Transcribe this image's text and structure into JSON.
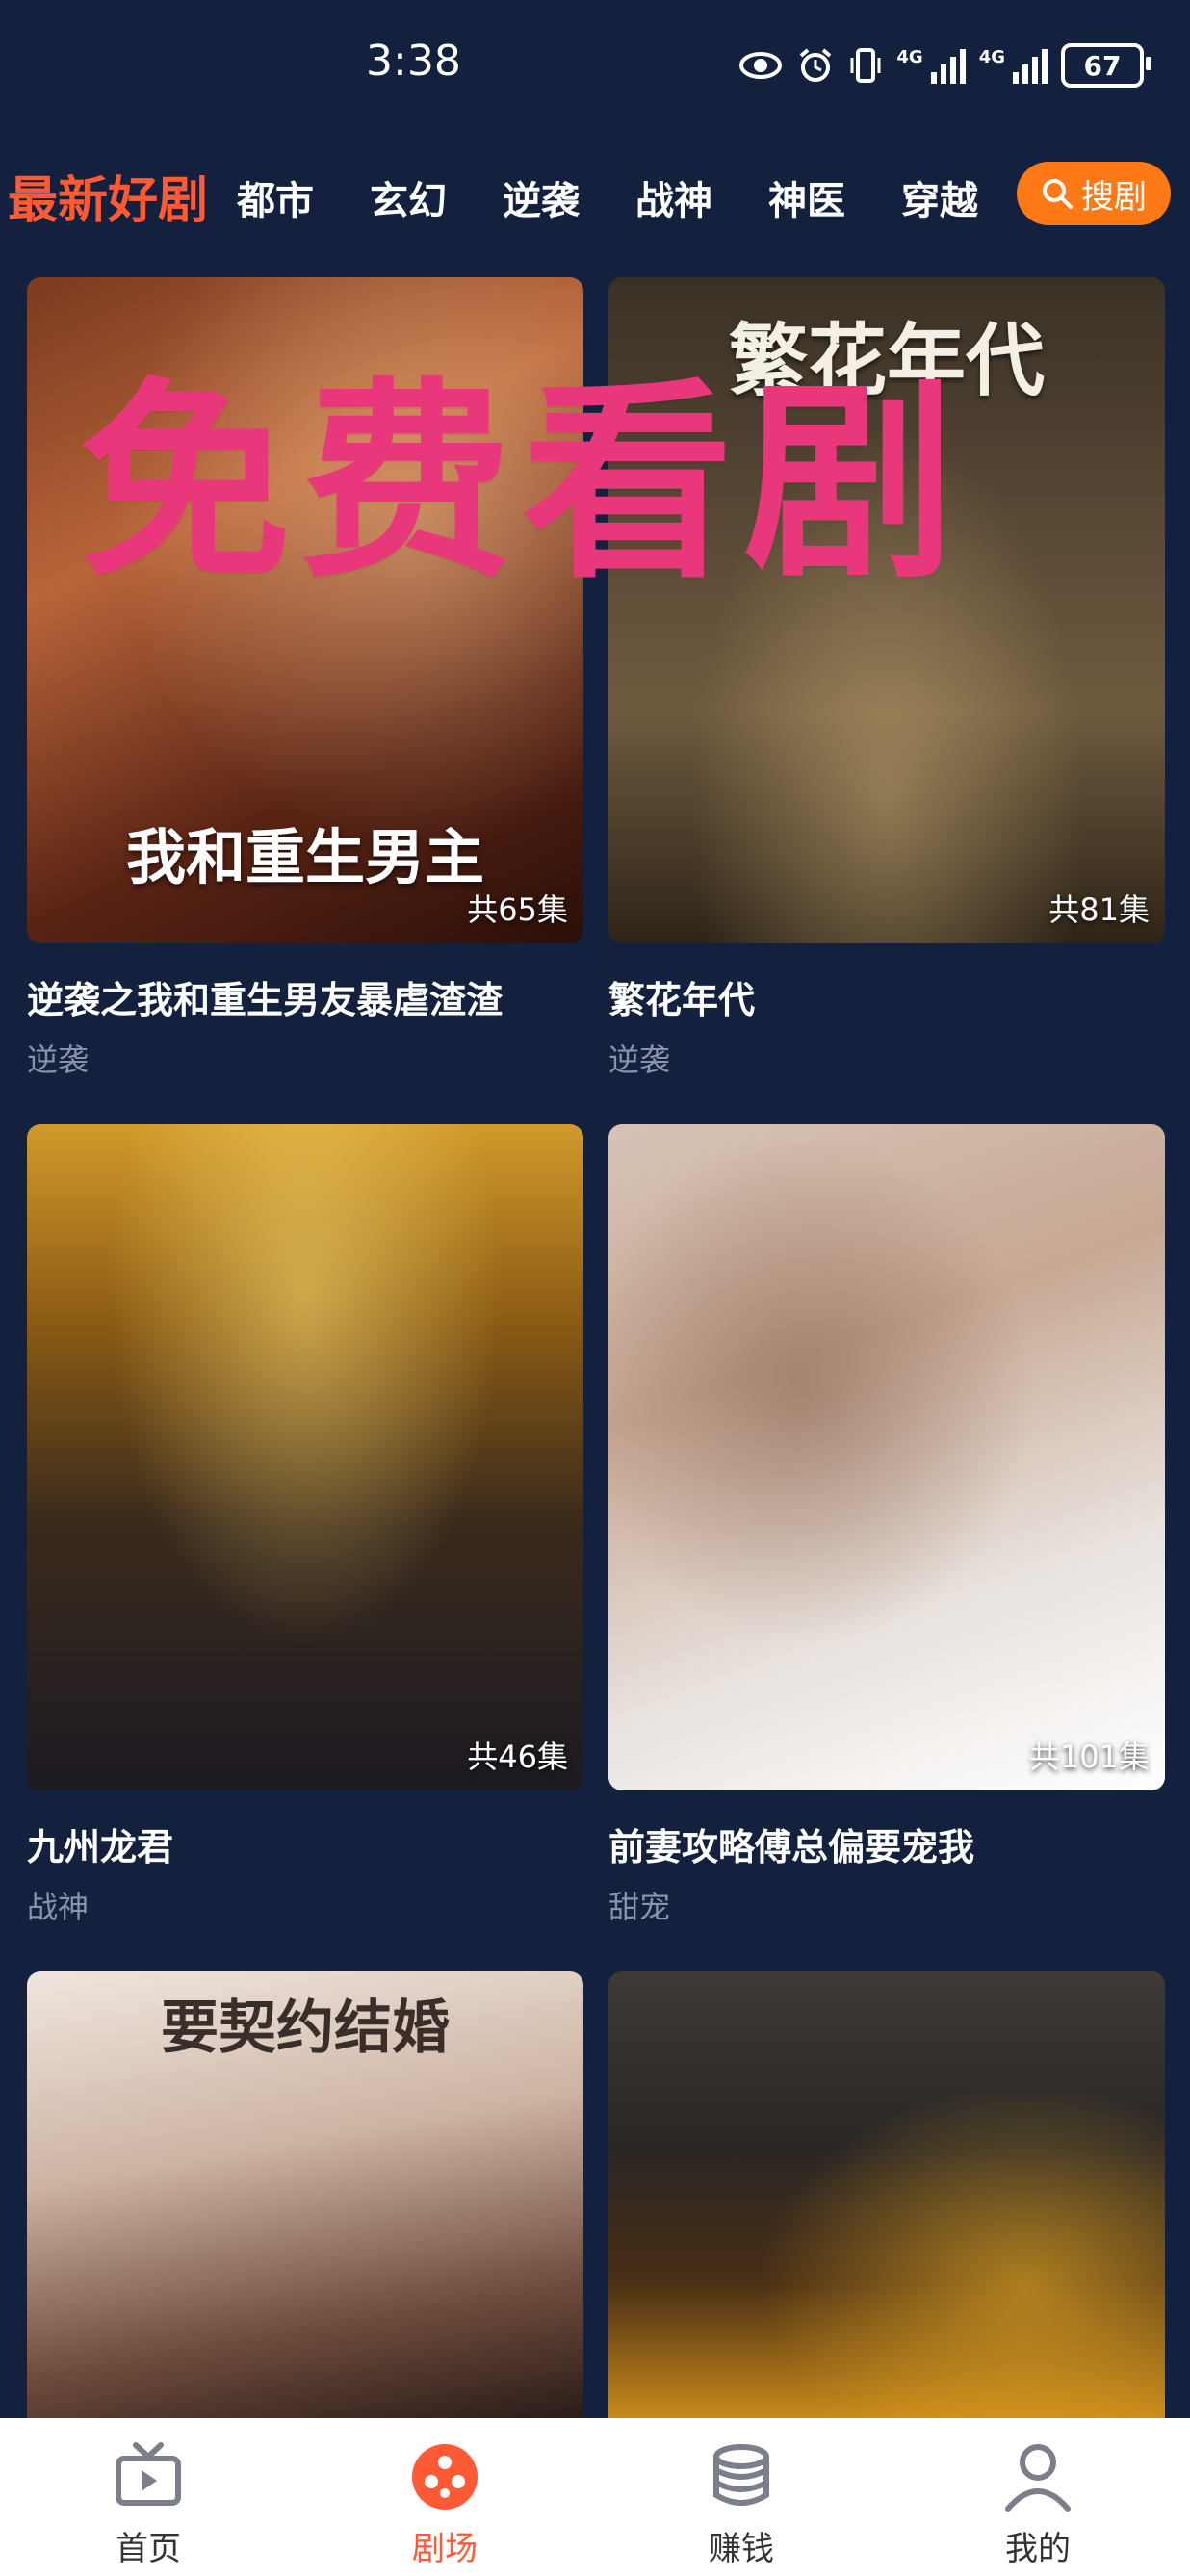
{
  "status_bar": {
    "time": "3:38",
    "battery": "67",
    "signal1": "4G",
    "signal2": "4G"
  },
  "tabs": {
    "active": "最新好剧",
    "items": [
      "都市",
      "玄幻",
      "逆袭",
      "战神",
      "神医",
      "穿越"
    ],
    "search_label": "搜剧"
  },
  "watermark": "免费看剧",
  "cards": [
    {
      "title": "逆袭之我和重生男友暴虐渣渣",
      "genre": "逆袭",
      "episodes": "共65集",
      "poster_text": "我和重生男主"
    },
    {
      "title": "繁花年代",
      "genre": "逆袭",
      "episodes": "共81集",
      "poster_text": "繁花年代"
    },
    {
      "title": "九州龙君",
      "genre": "战神",
      "episodes": "共46集",
      "poster_text": ""
    },
    {
      "title": "前妻攻略傅总偏要宠我",
      "genre": "甜宠",
      "episodes": "共101集",
      "poster_text": ""
    },
    {
      "poster_text": "要契约结婚"
    },
    {
      "poster_text": ""
    }
  ],
  "bottom_nav": [
    {
      "label": "首页",
      "icon": "tv-icon"
    },
    {
      "label": "剧场",
      "icon": "theater-icon"
    },
    {
      "label": "赚钱",
      "icon": "coins-icon"
    },
    {
      "label": "我的",
      "icon": "profile-icon"
    }
  ],
  "colors": {
    "background": "#13213f",
    "accent": "#ff5a36",
    "search": "#ff7a16",
    "watermark": "#e8387b"
  }
}
